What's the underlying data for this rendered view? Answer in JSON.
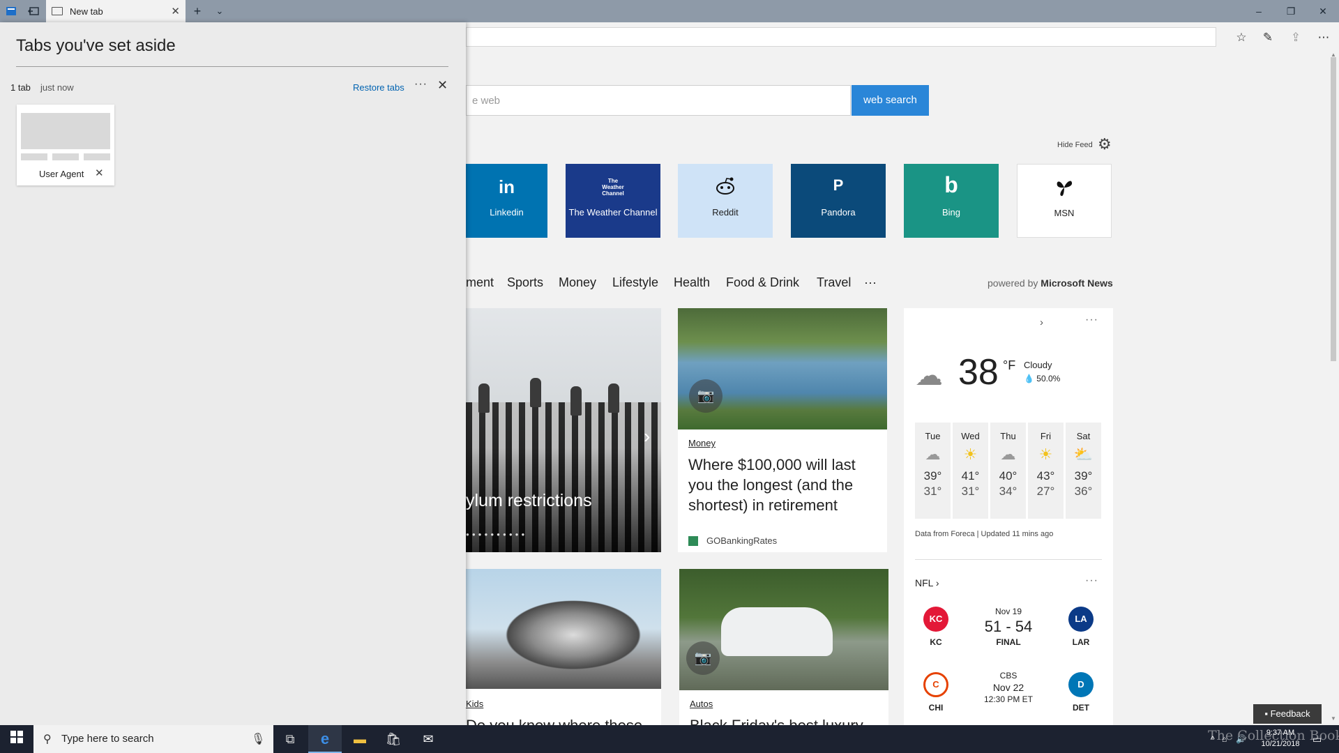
{
  "browser": {
    "tab_title": "New tab"
  },
  "aside": {
    "title": "Tabs you've set aside",
    "count": "1 tab",
    "time": "just now",
    "restore_label": "Restore tabs",
    "tab_label": "User Agent"
  },
  "page": {
    "search_placeholder": "e web",
    "search_button": "web search",
    "hide_feed": "Hide Feed",
    "tiles": [
      {
        "label": "Linkedin",
        "logo": "in",
        "color": "#0073b1"
      },
      {
        "label": "The Weather Channel",
        "logo": "The Weather Channel",
        "color": "#1a3a8a"
      },
      {
        "label": "Reddit",
        "logo": "reddit-alien",
        "color": "#cfe3f7"
      },
      {
        "label": "Pandora",
        "logo": "P",
        "color": "#0b4a7a"
      },
      {
        "label": "Bing",
        "logo": "b",
        "color": "#1a9485"
      },
      {
        "label": "MSN",
        "logo": "butterfly",
        "color": "#ffffff"
      }
    ],
    "categories": [
      "ment",
      "Sports",
      "Money",
      "Lifestyle",
      "Health",
      "Food & Drink",
      "Travel",
      "···"
    ],
    "powered_prefix": "powered by",
    "powered_brand": "Microsoft News",
    "hero_title": "ylum restrictions",
    "article1": {
      "tag": "Money",
      "title": "Where $100,000 will last you the longest (and the shortest) in retirement",
      "source": "GOBankingRates"
    },
    "article2_tag": "Kids",
    "article2_title": "Do you know where these",
    "article3_tag": "Autos",
    "article3_title": "Black Friday's best luxury"
  },
  "weather": {
    "temp": "38",
    "unit": "°F",
    "condition": "Cloudy",
    "precip": "50.0%",
    "forecast": [
      {
        "day": "Tue",
        "icon": "cloudy-icon",
        "hi": "39°",
        "lo": "31°"
      },
      {
        "day": "Wed",
        "icon": "sunny-icon",
        "hi": "41°",
        "lo": "31°"
      },
      {
        "day": "Thu",
        "icon": "cloudy-icon",
        "hi": "40°",
        "lo": "34°"
      },
      {
        "day": "Fri",
        "icon": "sunny-icon",
        "hi": "43°",
        "lo": "27°"
      },
      {
        "day": "Sat",
        "icon": "partly-cloudy-icon",
        "hi": "39°",
        "lo": "36°"
      }
    ],
    "data_source": "Data from Foreca | Updated 11 mins ago"
  },
  "nfl": {
    "title": "NFL",
    "game1": {
      "home": "KC",
      "away": "LAR",
      "date": "Nov 19",
      "score": "51 - 54",
      "status": "FINAL"
    },
    "game2": {
      "home": "CHI",
      "away": "DET",
      "network": "CBS",
      "date": "Nov 22",
      "time": "12:30 PM ET"
    }
  },
  "taskbar": {
    "search_placeholder": "Type here to search",
    "time": "9:37 AM",
    "date": "10/21/2018",
    "watermark": "The Collection Book"
  },
  "feedback_label": "Feedback"
}
